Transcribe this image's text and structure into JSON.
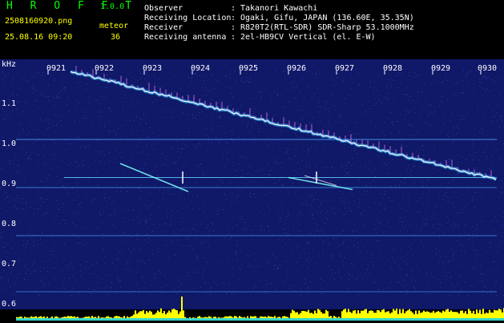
{
  "header": {
    "logo": "H R O F F T",
    "version": "1.0.0",
    "filename": "2508160920.png",
    "datetime": "25.08.16 09:20",
    "meteor_label": "meteor",
    "meteor_count": "36"
  },
  "info": [
    {
      "label": "Observer",
      "value": "Takanori Kawachi"
    },
    {
      "label": "Receiving Location",
      "value": "Ogaki, Gifu, JAPAN (136.60E, 35.35N)"
    },
    {
      "label": "Receiver",
      "value": "R820T2(RTL-SDR) SDR-Sharp 53.1000MHz"
    },
    {
      "label": "Receiving antenna",
      "value": "2el-HB9CV Vertical (el. E-W)"
    }
  ],
  "plot": {
    "y_unit": "kHz",
    "y_ticks": [
      "1.1",
      "1.0",
      "0.9",
      "0.8",
      "0.7",
      "0.6"
    ],
    "x_ticks": [
      "0921",
      "0922",
      "0923",
      "0924",
      "0925",
      "0926",
      "0927",
      "0928",
      "0929",
      "0930"
    ],
    "colors": {
      "background": "#101868",
      "noise": "#2a3aa0",
      "trace_hot": "#ffffff",
      "trace_mid": "#30c0ff",
      "echo": "#80ffff",
      "level_bar": "#ffff00",
      "level_base": "#00c8ff"
    }
  }
}
